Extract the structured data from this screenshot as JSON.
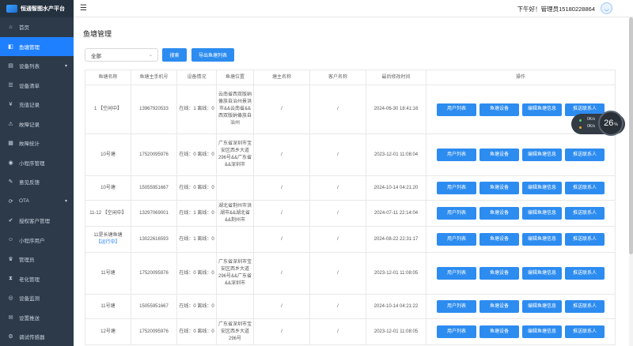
{
  "app": {
    "title": "恒通智图水产平台"
  },
  "topbar": {
    "greeting": "下午好！管理员15180228864"
  },
  "sidebar": {
    "items": [
      {
        "label": "首页",
        "icon": "home-icon",
        "glyph": "⌂"
      },
      {
        "label": "鱼塘管理",
        "icon": "fishpond-icon",
        "glyph": "◧"
      },
      {
        "label": "设备列表",
        "icon": "device-list-icon",
        "glyph": "▤",
        "caret": "▾"
      },
      {
        "label": "设备清单",
        "icon": "checklist-icon",
        "glyph": "☰"
      },
      {
        "label": "充值记录",
        "icon": "recharge-icon",
        "glyph": "¥"
      },
      {
        "label": "故障记录",
        "icon": "fault-icon",
        "glyph": "⚠"
      },
      {
        "label": "故障统计",
        "icon": "statistics-icon",
        "glyph": "▦"
      },
      {
        "label": "小程序管理",
        "icon": "miniapp-icon",
        "glyph": "◉"
      },
      {
        "label": "意见反馈",
        "icon": "feedback-icon",
        "glyph": "✎"
      },
      {
        "label": "OTA",
        "icon": "ota-icon",
        "glyph": "⟳",
        "caret": "▾"
      },
      {
        "label": "授权客户管理",
        "icon": "authorized-client-icon",
        "glyph": "✔"
      },
      {
        "label": "小程序用户",
        "icon": "miniapp-user-icon",
        "glyph": "☺"
      },
      {
        "label": "管理员",
        "icon": "admin-icon",
        "glyph": "♛"
      },
      {
        "label": "老化管理",
        "icon": "aging-icon",
        "glyph": "⧗"
      },
      {
        "label": "设备监测",
        "icon": "monitor-icon",
        "glyph": "◎"
      },
      {
        "label": "设置推送",
        "icon": "push-settings-icon",
        "glyph": "✉"
      },
      {
        "label": "调试传感器",
        "icon": "sensor-debug-icon",
        "glyph": "⚙"
      }
    ]
  },
  "main": {
    "title": "鱼塘管理",
    "filter": {
      "selected": "全部",
      "chevron": "⌄"
    },
    "search_label": "搜索",
    "export_label": "导出鱼塘列表"
  },
  "table": {
    "headers": [
      "鱼塘名称",
      "鱼塘主手机号",
      "设备情况",
      "鱼塘位置",
      "塘主名称",
      "客户名称",
      "最后修改时间",
      "操作"
    ],
    "row_actions": [
      "用户列表",
      "鱼塘设备",
      "编辑鱼塘信息",
      "推送联系人"
    ],
    "rows": [
      {
        "name": "1",
        "tag": "【空闲中】",
        "phone": "13967920533",
        "devices": "在线：1  离线：0",
        "location": "云南省西双版纳傣族自治州景洪市&&云南省&&西双版纳傣族自治州",
        "owner": "/",
        "customer": "/",
        "modified": "2024-06-30 18:41:16"
      },
      {
        "name": "10号塘",
        "tag": "",
        "phone": "17520095976",
        "devices": "在线：0  离线：0",
        "location": "广东省深圳市宝安区西乡大道296号&&广东省&&深圳市",
        "owner": "/",
        "customer": "/",
        "modified": "2023-12-01 11:08:04"
      },
      {
        "name": "10号塘",
        "tag": "",
        "phone": "15055951667",
        "devices": "在线：0  离线：0",
        "location": "",
        "owner": "/",
        "customer": "/",
        "modified": "2024-10-14 04:21:20"
      },
      {
        "name": "11-12",
        "tag": "【空闲中】",
        "phone": "13297069001",
        "devices": "在线：1  离线：0",
        "location": "湖北省荆州市洪湖市&&湖北省&&荆州市",
        "owner": "/",
        "customer": "/",
        "modified": "2024-07-11 22:14:04"
      },
      {
        "name": "11是长塘鱼塘",
        "tag": "【运行中】",
        "phone": "13022616593",
        "devices": "在线：1  离线：0",
        "location": "",
        "owner": "/",
        "customer": "/",
        "modified": "2024-08-22 22:31:17"
      },
      {
        "name": "11号塘",
        "tag": "",
        "phone": "17520095976",
        "devices": "在线：0  离线：0",
        "location": "广东省深圳市宝安区西乡大道296号&&广东省&&深圳市",
        "owner": "/",
        "customer": "/",
        "modified": "2023-12-01 11:08:05"
      },
      {
        "name": "11号塘",
        "tag": "",
        "phone": "15055951667",
        "devices": "在线：0  离线：0",
        "location": "",
        "owner": "/",
        "customer": "/",
        "modified": "2024-10-14 04:21:22"
      },
      {
        "name": "12号塘",
        "tag": "",
        "phone": "17520095976",
        "devices": "在线：0  离线：0",
        "location": "广东省深圳市宝安区西乡大道296号",
        "owner": "/",
        "customer": "/",
        "modified": "2023-12-01 11:08:05"
      }
    ]
  },
  "widget": {
    "percent": "26",
    "unit": "%",
    "up": "0K/s",
    "down": "0K/s"
  },
  "colors": {
    "sidebar_bg": "#2c3a4a",
    "active": "#1f80ff",
    "button": "#2d8cf0"
  }
}
